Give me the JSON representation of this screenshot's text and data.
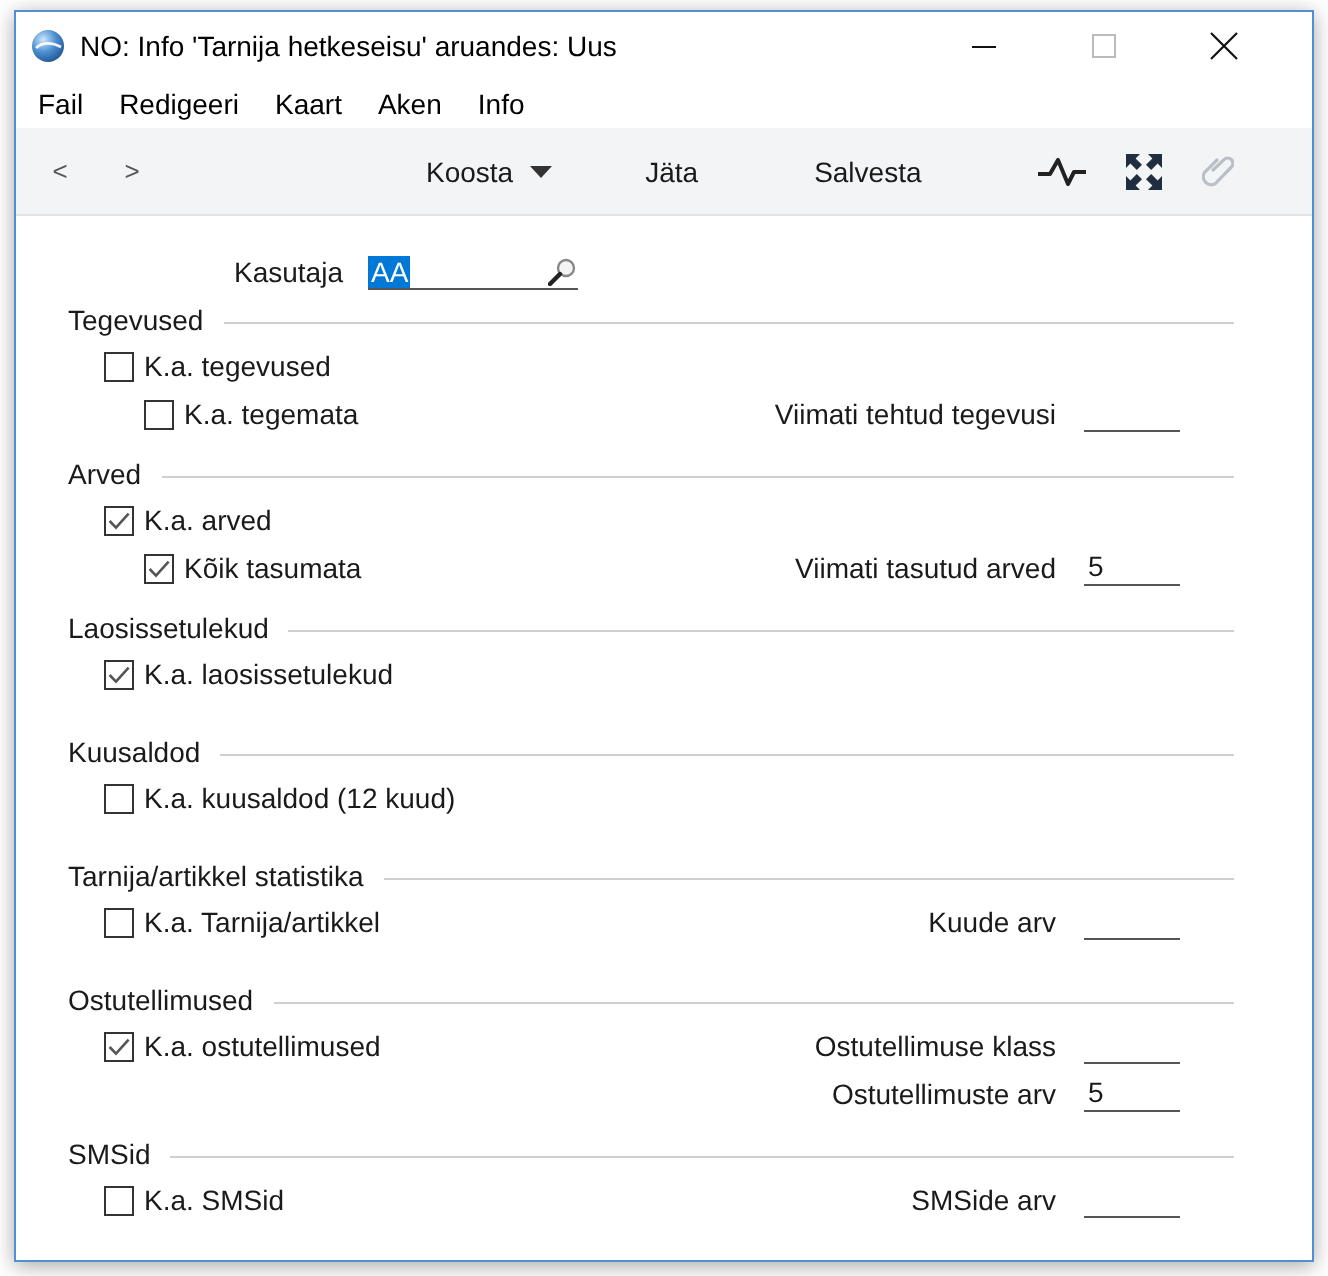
{
  "window": {
    "title": "NO: Info 'Tarnija hetkeseisu' aruandes: Uus"
  },
  "menu": [
    "Fail",
    "Redigeeri",
    "Kaart",
    "Aken",
    "Info"
  ],
  "toolbar": {
    "nav": [
      "<",
      ">"
    ],
    "buttons": [
      {
        "label": "Koosta",
        "kind": "dropdown"
      },
      {
        "label": "Jäta",
        "kind": "plain"
      },
      {
        "label": "Salvesta",
        "kind": "plain"
      }
    ]
  },
  "user_field": {
    "label": "Kasutaja",
    "value": "AA",
    "text_selected": true
  },
  "sections": [
    {
      "title": "Tegevused",
      "options": [
        {
          "label": "K.a. tegevused",
          "checked": false,
          "children": [
            {
              "label": "K.a. tegemata",
              "checked": false
            }
          ]
        }
      ],
      "fields": [
        {
          "label": "Viimati tehtud tegevusi"
        }
      ]
    },
    {
      "title": "Arved",
      "options": [
        {
          "label": "K.a. arved",
          "checked": true,
          "children": [
            {
              "label": "Kõik tasumata",
              "checked": true
            }
          ]
        }
      ],
      "fields": [
        {
          "label": "Viimati tasutud arved",
          "value": "5"
        }
      ]
    },
    {
      "title": "Laosissetulekud",
      "options": [
        {
          "label": "K.a. laosissetulekud",
          "checked": true
        }
      ]
    },
    {
      "title": "Kuusaldod",
      "options": [
        {
          "label": "K.a. kuusaldod (12 kuud)",
          "checked": false
        }
      ]
    },
    {
      "title": "Tarnija/artikkel statistika",
      "options": [
        {
          "label": "K.a. Tarnija/artikkel",
          "checked": false
        }
      ],
      "fields": [
        {
          "label": "Kuude arv"
        }
      ]
    },
    {
      "title": "Ostutellimused",
      "options": [
        {
          "label": "K.a. ostutellimused",
          "checked": true
        }
      ],
      "fields": [
        {
          "label": "Ostutellimuse klass"
        },
        {
          "label": "Ostutellimuste arv",
          "value": "5"
        }
      ]
    },
    {
      "title": "SMSid",
      "options": [
        {
          "label": "K.a. SMSid",
          "checked": false
        }
      ],
      "fields": [
        {
          "label": "SMSide arv"
        }
      ]
    }
  ]
}
